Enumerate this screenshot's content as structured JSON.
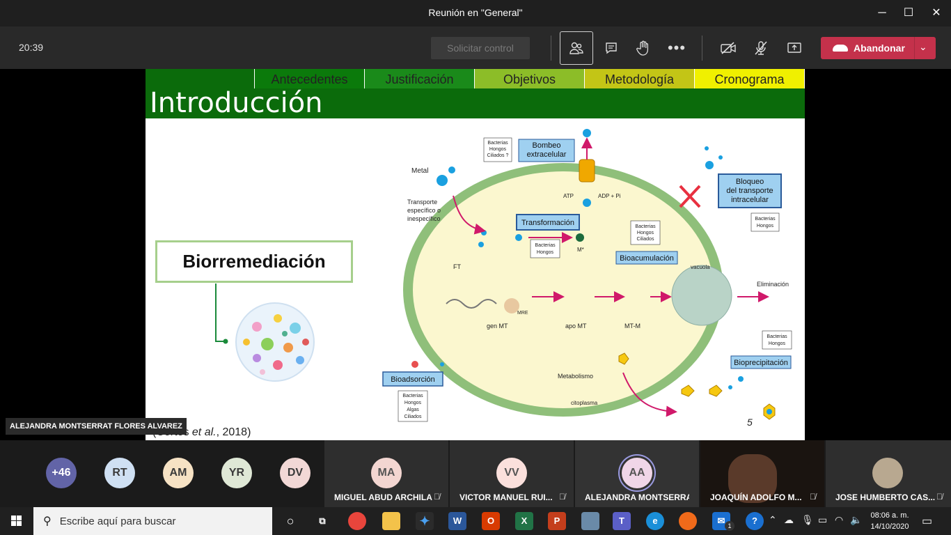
{
  "window": {
    "title": "Reunión en \"General\"",
    "minimize": "─",
    "maximize": "☐",
    "close": "✕"
  },
  "toolbar": {
    "timer": "20:39",
    "request_control": "Solicitar control",
    "leave_label": "Abandonar",
    "buttons": [
      "participants-icon",
      "chat-icon",
      "raise-hand-icon",
      "more-icon",
      "camera-off-icon",
      "mic-off-icon",
      "share-tray-icon"
    ]
  },
  "slide": {
    "tabs": [
      "Antecedentes",
      "Justificación",
      "Objetivos",
      "Metodología",
      "Cronograma"
    ],
    "tab_colors": [
      "#0b7a0b",
      "#1a8a1a",
      "#8cbd28",
      "#c3c516",
      "#f0f000"
    ],
    "title": "Introducción",
    "bio_label": "Biorremediación",
    "citation_pre": "(Cortés ",
    "citation_italic": "et al.",
    "citation_post": ", 2018)",
    "diagram": {
      "bombeo": [
        "Bombeo",
        "extracelular"
      ],
      "bombeo_orgs": [
        "Bacterias",
        "Hongos",
        "Ciliados ?"
      ],
      "metal": "Metal",
      "transporte": [
        "Transporte",
        "específico o",
        "inespecífico"
      ],
      "atp": "ATP",
      "adp": "ADP + Pi",
      "bloqueo": [
        "Bloqueo",
        "del transporte",
        "intracelular"
      ],
      "bloqueo_orgs": [
        "Bacterias",
        "Hongos"
      ],
      "transformacion": "Transformación",
      "transf_orgs": [
        "Bacterias",
        "Hongos"
      ],
      "m_star": "M*",
      "bioacum_orgs": [
        "Bacterias",
        "Hongos",
        "Ciliados"
      ],
      "bioacumulacion": "Bioacumulación",
      "ft": "FT",
      "vacuola": "vacuola",
      "eliminacion": "Eliminación",
      "gen_mt": "gen MT",
      "apo_mt": "apo MT",
      "mt_m": "MT-M",
      "mre": "MRE",
      "biop_orgs": [
        "Bacterias",
        "Hongos"
      ],
      "bioprecipitacion": "Bioprecipitación",
      "bioadsorcion": "Bioadsorción",
      "bioads_orgs": [
        "Bacterias",
        "Hongos",
        "Algas",
        "Ciliados"
      ],
      "metabolismo": "Metabolismo",
      "citoplasma": "citoplasma",
      "page_num": "5"
    }
  },
  "presenter_name": "ALEJANDRA MONTSERRAT FLORES ALVAREZ",
  "participants": {
    "more": "+46",
    "avatars": [
      {
        "initials": "RT",
        "color": "#cfe0f3"
      },
      {
        "initials": "AM",
        "color": "#f6e2c4"
      },
      {
        "initials": "YR",
        "color": "#dfe8d6"
      },
      {
        "initials": "DV",
        "color": "#f2d8d6"
      }
    ],
    "tiles": [
      {
        "initials": "MA",
        "name": "MIGUEL ABUD ARCHILA"
      },
      {
        "initials": "VV",
        "name": "VICTOR MANUEL RUI..."
      },
      {
        "initials": "AA",
        "name": "ALEJANDRA MONTSERRA..."
      },
      {
        "initials": "",
        "name": "JOAQUÍN ADOLFO M..."
      },
      {
        "initials": "",
        "name": "JOSE HUMBERTO CAS..."
      }
    ]
  },
  "taskbar": {
    "search_placeholder": "Escribe aquí para buscar",
    "time": "08:06 a. m.",
    "date": "14/10/2020",
    "mail_badge": "1"
  }
}
